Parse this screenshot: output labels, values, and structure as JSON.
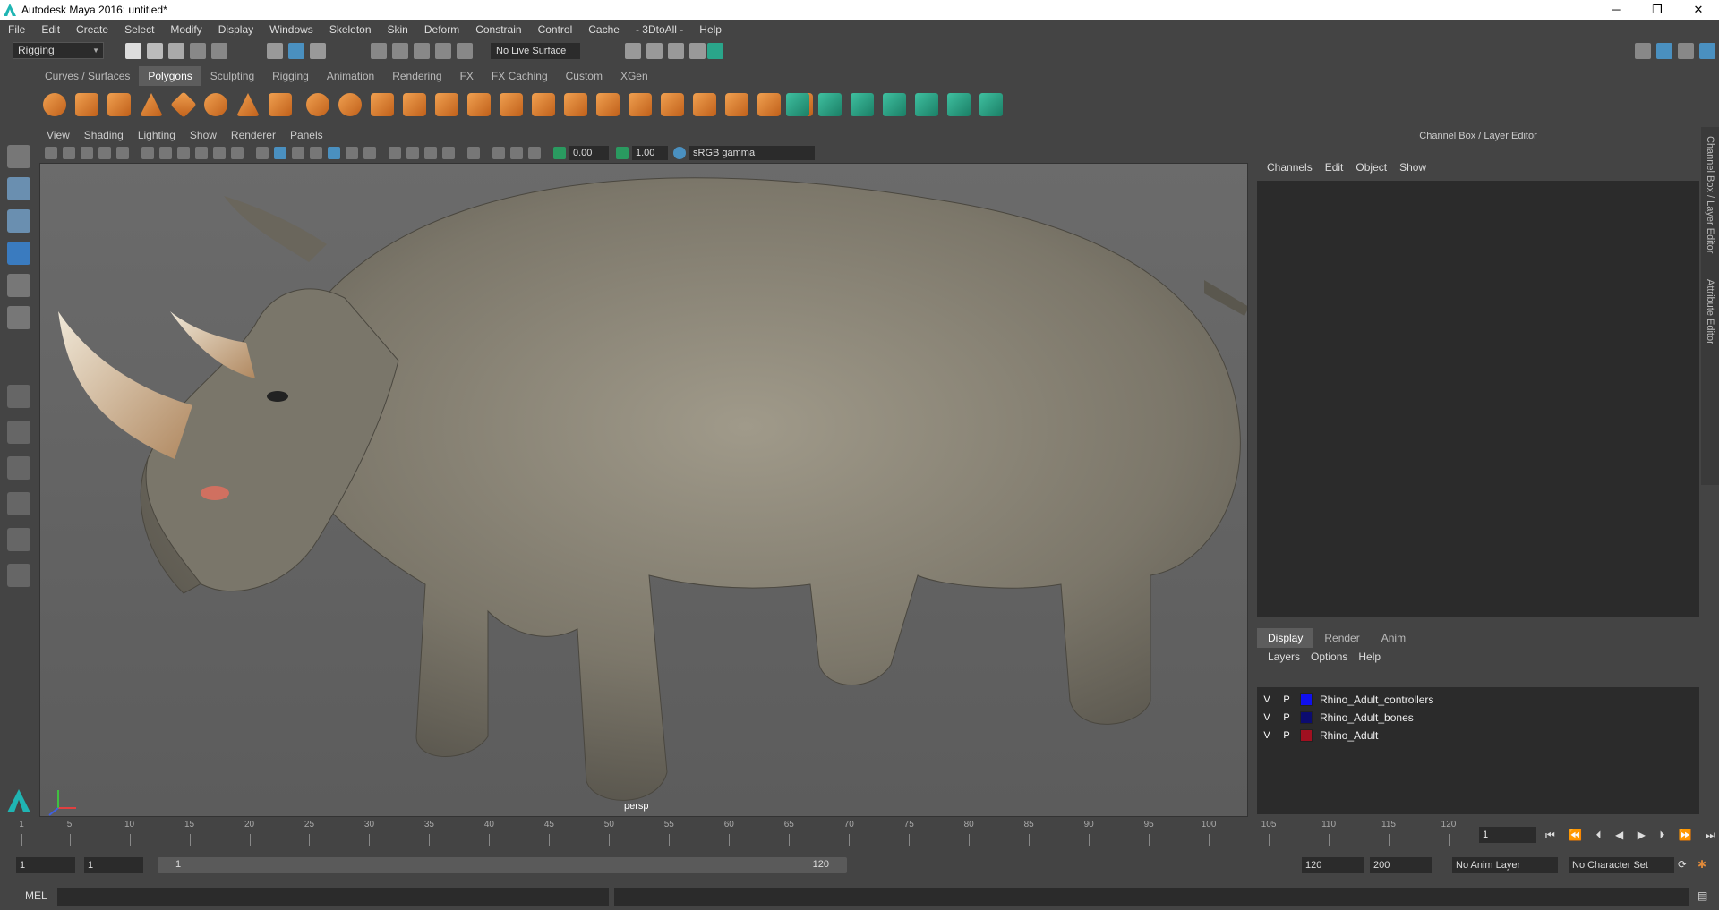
{
  "window": {
    "title": "Autodesk Maya 2016: untitled*"
  },
  "menubar": [
    "File",
    "Edit",
    "Create",
    "Select",
    "Modify",
    "Display",
    "Windows",
    "Skeleton",
    "Skin",
    "Deform",
    "Constrain",
    "Control",
    "Cache",
    "- 3DtoAll -",
    "Help"
  ],
  "statusline": {
    "menuset": "Rigging",
    "live_surface": "No Live Surface"
  },
  "shelf": {
    "tabs": [
      "Curves / Surfaces",
      "Polygons",
      "Sculpting",
      "Rigging",
      "Animation",
      "Rendering",
      "FX",
      "FX Caching",
      "Custom",
      "XGen"
    ],
    "active_tab": "Polygons"
  },
  "panel": {
    "menu": [
      "View",
      "Shading",
      "Lighting",
      "Show",
      "Renderer",
      "Panels"
    ],
    "exposure": "0.00",
    "gamma": "1.00",
    "color_space": "sRGB gamma",
    "camera": "persp"
  },
  "channel_box": {
    "title": "Channel Box / Layer Editor",
    "menu": [
      "Channels",
      "Edit",
      "Object",
      "Show"
    ],
    "side_tabs": [
      "Channel Box / Layer Editor",
      "Attribute Editor"
    ]
  },
  "layer_editor": {
    "tabs": [
      "Display",
      "Render",
      "Anim"
    ],
    "active_tab": "Display",
    "menu": [
      "Layers",
      "Options",
      "Help"
    ],
    "layers": [
      {
        "v": "V",
        "p": "P",
        "name": "Rhino_Adult_controllers",
        "color": "#1010ee"
      },
      {
        "v": "V",
        "p": "P",
        "name": "Rhino_Adult_bones",
        "color": "#0c0c70"
      },
      {
        "v": "V",
        "p": "P",
        "name": "Rhino_Adult",
        "color": "#a01020"
      }
    ]
  },
  "timeslider": {
    "ticks": [
      "1",
      "5",
      "10",
      "15",
      "20",
      "25",
      "30",
      "35",
      "40",
      "45",
      "50",
      "55",
      "60",
      "65",
      "70",
      "75",
      "80",
      "85",
      "90",
      "95",
      "100",
      "105",
      "110",
      "115",
      "120"
    ],
    "current_frame": "1"
  },
  "range": {
    "start": "1",
    "playback_start": "1",
    "slider_start": "1",
    "slider_end": "120",
    "playback_end": "120",
    "end": "200",
    "anim_layer": "No Anim Layer",
    "character_set": "No Character Set"
  },
  "command_line": {
    "label": "MEL"
  },
  "colors": {
    "maya_teal": "#1fb5b3",
    "shelf_orange": "#e08a3a",
    "rig_green": "#3fc0a0"
  }
}
